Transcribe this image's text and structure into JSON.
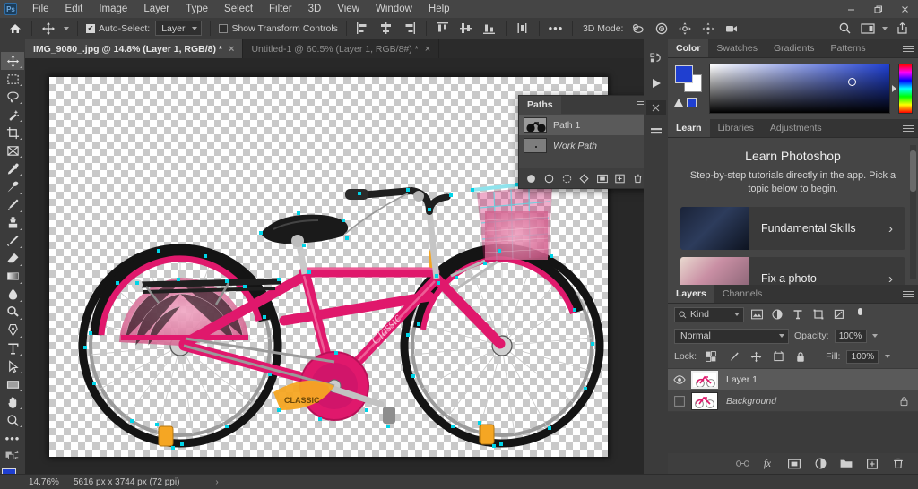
{
  "app": {
    "name": "Adobe Photoshop",
    "logo_text": "Ps"
  },
  "menubar": {
    "items": [
      "File",
      "Edit",
      "Image",
      "Layer",
      "Type",
      "Select",
      "Filter",
      "3D",
      "View",
      "Window",
      "Help"
    ],
    "window_controls": [
      "minimize",
      "maximize",
      "close"
    ]
  },
  "options_bar": {
    "home_icon": "home-icon",
    "tool_icon": "move-tool-icon",
    "auto_select_label": "Auto-Select:",
    "auto_select_checked": true,
    "auto_select_target": "Layer",
    "show_transform_label": "Show Transform Controls",
    "show_transform_checked": false,
    "align_icons": [
      "align-left",
      "align-center-h",
      "align-right",
      "align-top",
      "align-center-v",
      "align-bottom",
      "distribute"
    ],
    "more_label": "•••",
    "mode3d_label": "3D Mode:",
    "mode3d_icons": [
      "orbit-3d-icon",
      "roll-3d-icon",
      "pan-3d-icon",
      "slide-3d-icon",
      "camera-3d-icon"
    ],
    "right_icons": [
      "search-icon",
      "workspace-icon",
      "share-icon"
    ]
  },
  "tabs": [
    {
      "title": "IMG_9080_.jpg @ 14.8% (Layer 1, RGB/8) *",
      "active": true,
      "close": "×"
    },
    {
      "title": "Untitled-1 @ 60.5% (Layer 1, RGB/8#) *",
      "active": false,
      "close": "×"
    }
  ],
  "toolbar": {
    "tools": [
      {
        "name": "move-tool",
        "active": true
      },
      {
        "name": "rectangular-marquee-tool",
        "active": false
      },
      {
        "name": "lasso-tool",
        "active": false
      },
      {
        "name": "magic-wand-tool",
        "active": false
      },
      {
        "name": "crop-tool",
        "active": false
      },
      {
        "name": "frame-tool",
        "active": false
      },
      {
        "name": "eyedropper-tool",
        "active": false
      },
      {
        "name": "spot-healing-brush-tool",
        "active": false
      },
      {
        "name": "brush-tool",
        "active": false
      },
      {
        "name": "clone-stamp-tool",
        "active": false
      },
      {
        "name": "history-brush-tool",
        "active": false
      },
      {
        "name": "eraser-tool",
        "active": false
      },
      {
        "name": "gradient-tool",
        "active": false
      },
      {
        "name": "blur-tool",
        "active": false
      },
      {
        "name": "dodge-tool",
        "active": false
      },
      {
        "name": "pen-tool",
        "active": false
      },
      {
        "name": "type-tool",
        "active": false
      },
      {
        "name": "path-selection-tool",
        "active": false
      },
      {
        "name": "rectangle-tool",
        "active": false
      },
      {
        "name": "hand-tool",
        "active": false
      },
      {
        "name": "zoom-tool",
        "active": false
      },
      {
        "name": "edit-toolbar-tool",
        "active": false
      },
      {
        "name": "quick-mask-tool",
        "active": false
      }
    ],
    "foreground_color": "#1f3fd0",
    "background_color": "#ffffff"
  },
  "paths_panel": {
    "tab_label": "Paths",
    "rows": [
      {
        "name": "Path 1",
        "selected": true,
        "italic": false
      },
      {
        "name": "Work Path",
        "selected": false,
        "italic": true
      }
    ],
    "footer_buttons": [
      "fill-path-icon",
      "stroke-path-icon",
      "load-selection-icon",
      "make-work-path-icon",
      "add-mask-icon",
      "new-path-icon",
      "delete-path-icon"
    ]
  },
  "color_panel": {
    "tabs": [
      {
        "label": "Color",
        "active": true
      },
      {
        "label": "Swatches",
        "active": false
      },
      {
        "label": "Gradients",
        "active": false
      },
      {
        "label": "Patterns",
        "active": false
      }
    ],
    "foreground_color": "#1f3fd0",
    "background_color": "#ffffff",
    "warning_icon": "out-of-gamut-icon"
  },
  "learn_panel": {
    "tabs": [
      {
        "label": "Learn",
        "active": true
      },
      {
        "label": "Libraries",
        "active": false
      },
      {
        "label": "Adjustments",
        "active": false
      }
    ],
    "title": "Learn Photoshop",
    "subtitle": "Step-by-step tutorials directly in the app. Pick a topic below to begin.",
    "cards": [
      {
        "label": "Fundamental Skills",
        "chevron": "›"
      },
      {
        "label": "Fix a photo",
        "chevron": "›"
      }
    ]
  },
  "layers_panel": {
    "tabs": [
      {
        "label": "Layers",
        "active": true
      },
      {
        "label": "Channels",
        "active": false
      }
    ],
    "filter_label": "Kind",
    "filter_icons": [
      "filter-pixel-icon",
      "filter-adjustment-icon",
      "filter-type-icon",
      "filter-shape-icon",
      "filter-smart-icon"
    ],
    "filter_toggle": "filter-toggle-icon",
    "blend_mode": "Normal",
    "opacity_label": "Opacity:",
    "opacity_value": "100%",
    "lock_label": "Lock:",
    "lock_icons": [
      "lock-transparent-icon",
      "lock-image-icon",
      "lock-position-icon",
      "lock-artboard-icon",
      "lock-all-icon"
    ],
    "fill_label": "Fill:",
    "fill_value": "100%",
    "rows": [
      {
        "name": "Layer 1",
        "visible": true,
        "selected": true,
        "locked": false,
        "italic": false
      },
      {
        "name": "Background",
        "visible": false,
        "selected": false,
        "locked": true,
        "italic": true
      }
    ],
    "footer_buttons": [
      "link-layers-icon",
      "layer-style-icon",
      "layer-mask-icon",
      "adjustment-layer-icon",
      "new-group-icon",
      "new-layer-icon",
      "delete-layer-icon"
    ]
  },
  "canvas_rail": {
    "icons": [
      "history-icon",
      "play-icon",
      "actions-close-icon",
      "properties-icon"
    ]
  },
  "statusbar": {
    "zoom": "14.76%",
    "dimensions": "5616 px x 3744 px (72 ppi)",
    "arrow": "›"
  },
  "document": {
    "artwork": "pink-bicycle-on-transparent-background",
    "bike_frame_color": "#e0186c",
    "bike_accent_color": "#ff8a1e",
    "path_anchor_color": "#00d4e8"
  }
}
